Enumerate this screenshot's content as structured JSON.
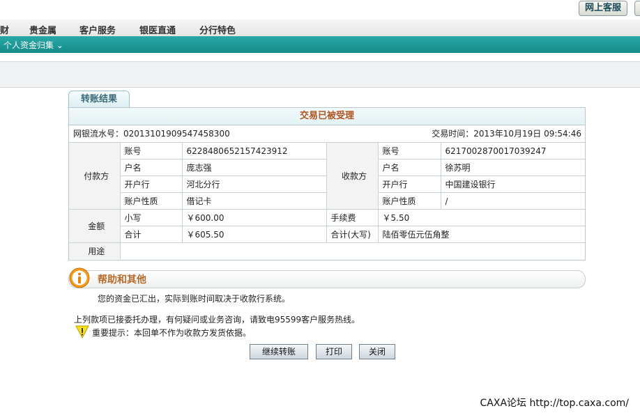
{
  "header": {
    "service_button": "网上客服"
  },
  "nav": {
    "items": [
      "财",
      "贵金属",
      "客户服务",
      "银医直通",
      "分行特色"
    ],
    "sub_item": "个人资金归集"
  },
  "tab": {
    "label": "转账结果"
  },
  "panel": {
    "status": "交易已被受理",
    "serial_label": "网银流水号：",
    "serial_value": "02013101909547458300",
    "time_label": "交易时间：",
    "time_value": "2013年10月19日 09:54:46"
  },
  "payer": {
    "section": "付款方",
    "account_label": "账号",
    "account": "6228480652157423912",
    "name_label": "户名",
    "name": "庞志强",
    "bank_label": "开户行",
    "bank": "河北分行",
    "type_label": "账户性质",
    "type": "借记卡"
  },
  "payee": {
    "section": "收款方",
    "account_label": "账号",
    "account": "6217002870017039247",
    "name_label": "户名",
    "name": "徐苏明",
    "bank_label": "开户行",
    "bank": "中国建设银行",
    "type_label": "账户性质",
    "type": "/"
  },
  "amount": {
    "section": "金额",
    "small_label": "小写",
    "small": "￥600.00",
    "fee_label": "手续费",
    "fee": "￥5.50",
    "total_label": "合计",
    "total": "￥605.50",
    "total_upper_label": "合计(大写)",
    "total_upper": "陆佰零伍元伍角整"
  },
  "purpose": {
    "label": "用途",
    "value": ""
  },
  "help": {
    "title": "帮助和其他",
    "text": "您的资金已汇出，实际到账时间取决于收款行系统。",
    "note": "上列款项已接委托办理，有何疑问或业务咨询，请致电95599客户服务热线。",
    "warning": "重要提示：本回单不作为收款方发货依据。"
  },
  "buttons": {
    "continue": "继续转账",
    "print": "打印",
    "close": "关闭"
  },
  "footer": {
    "watermark": "CAXA论坛 http://top.caxa.com/"
  },
  "colors": {
    "teal": "#1a9a97",
    "status_orange": "#b2541f",
    "help_title": "#b86a28"
  }
}
